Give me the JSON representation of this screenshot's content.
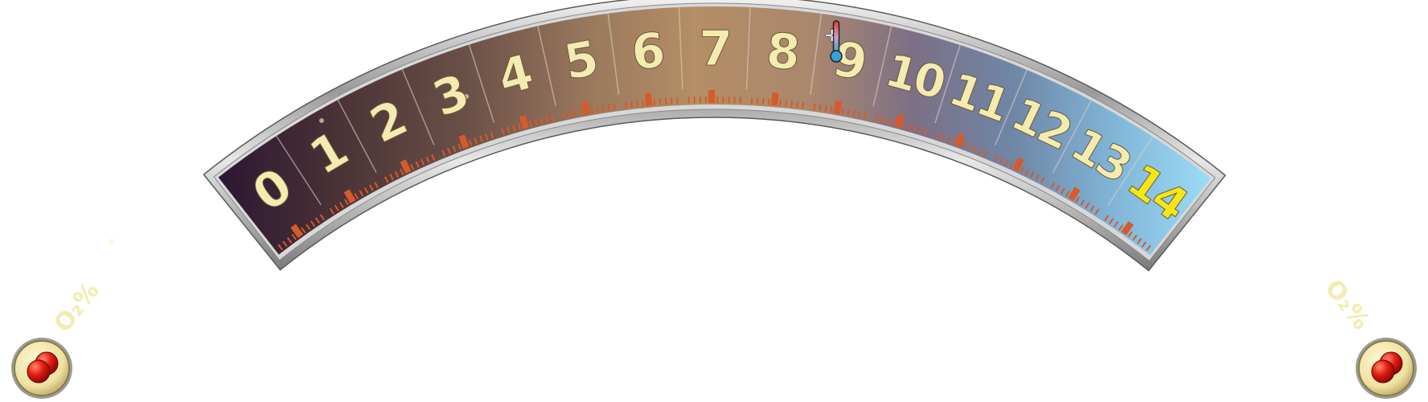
{
  "oxygen_track": {
    "unit_left": "O₂%",
    "unit_right": "O₂%",
    "steps": [
      {
        "label": "0",
        "highlight": false
      },
      {
        "label": "1",
        "highlight": false
      },
      {
        "label": "2",
        "highlight": false
      },
      {
        "label": "3",
        "highlight": false
      },
      {
        "label": "4",
        "highlight": false
      },
      {
        "label": "5",
        "highlight": false
      },
      {
        "label": "6",
        "highlight": false
      },
      {
        "label": "7",
        "highlight": false
      },
      {
        "label": "8",
        "highlight": false,
        "bonus": "thermometer-plus"
      },
      {
        "label": "9",
        "highlight": false
      },
      {
        "label": "10",
        "highlight": false
      },
      {
        "label": "11",
        "highlight": false
      },
      {
        "label": "12",
        "highlight": false
      },
      {
        "label": "13",
        "highlight": false
      },
      {
        "label": "14",
        "highlight": true
      }
    ],
    "bonus_symbol": "+",
    "end_pegs": [
      "red-marker-left",
      "red-marker-right"
    ]
  },
  "colors": {
    "number": "#f3ebb0",
    "number_max": "#f5e616",
    "tick": "#d65a2c",
    "frame_dark": "#6e6e6e",
    "frame_light": "#f2f2f2",
    "gradient_stops": [
      "#2c1733",
      "#5c4441",
      "#9b7a5e",
      "#b48e64",
      "#ad8a6a",
      "#7a7a92",
      "#6f8fb0",
      "#96d8f4"
    ]
  }
}
